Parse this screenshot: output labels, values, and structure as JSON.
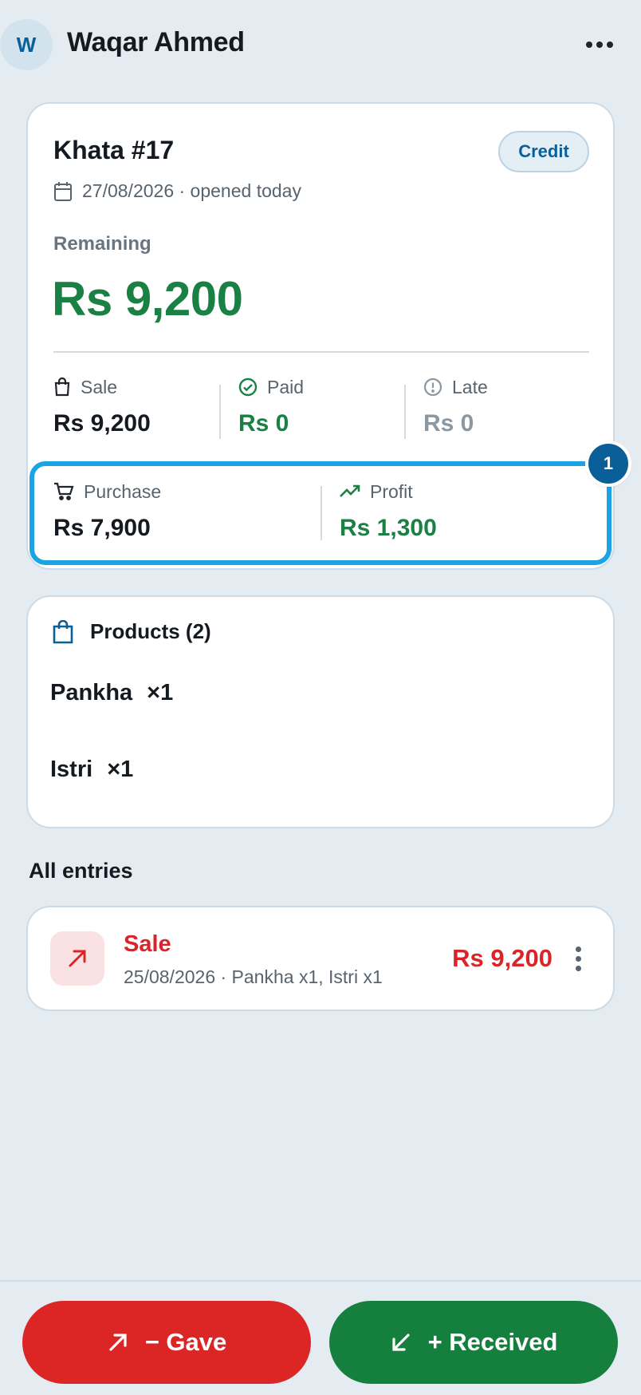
{
  "header": {
    "avatar_letter": "W",
    "title": "Waqar Ahmed"
  },
  "khata": {
    "title": "Khata #17",
    "badge": "Credit",
    "date_text": "27/08/2026 · opened today",
    "remaining_label": "Remaining",
    "remaining_value": "Rs 9,200",
    "stats": {
      "sale_label": "Sale",
      "sale_value": "Rs 9,200",
      "paid_label": "Paid",
      "paid_value": "Rs 0",
      "late_label": "Late",
      "late_value": "Rs 0"
    },
    "purchase_label": "Purchase",
    "purchase_value": "Rs 7,900",
    "profit_label": "Profit",
    "profit_value": "Rs 1,300",
    "step_badge": "1"
  },
  "products": {
    "title": "Products (2)",
    "items": [
      {
        "name": "Pankha",
        "qty": "×1"
      },
      {
        "name": "Istri",
        "qty": "×1"
      }
    ]
  },
  "entries": {
    "title": "All entries",
    "items": [
      {
        "type": "Sale",
        "subtitle": "25/08/2026 · Pankha x1, Istri x1",
        "amount": "Rs 9,200"
      }
    ]
  },
  "actions": {
    "gave_label": "− Gave",
    "received_label": "+ Received"
  },
  "colors": {
    "brand_blue": "#0b5f98",
    "green": "#1a8044",
    "red": "#d9252a",
    "highlight": "#1ba4e3",
    "background": "#e4ecf2"
  },
  "icons": [
    "more-horizontal-icon",
    "calendar-icon",
    "shopping-bag-icon",
    "check-circle-icon",
    "alert-circle-icon",
    "cart-icon",
    "trending-up-icon",
    "package-icon",
    "arrow-up-right-icon",
    "more-vertical-icon",
    "arrow-down-left-icon"
  ]
}
